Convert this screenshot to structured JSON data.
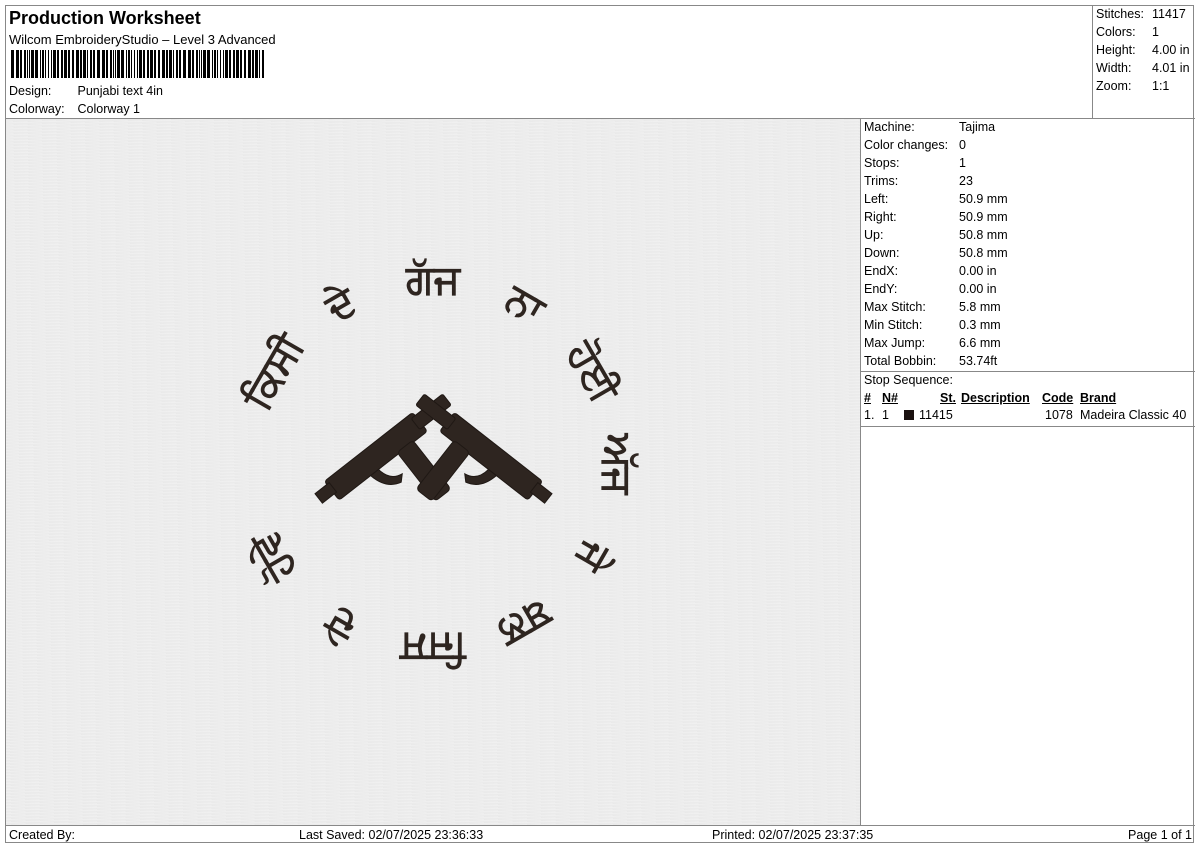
{
  "header": {
    "title": "Production Worksheet",
    "software": "Wilcom EmbroideryStudio – Level 3 Advanced",
    "design_label": "Design:",
    "design_value": "Punjabi text 4in",
    "colorway_label": "Colorway:",
    "colorway_value": "Colorway 1"
  },
  "stats": {
    "stitches_label": "Stitches:",
    "stitches_value": "11417",
    "colors_label": "Colors:",
    "colors_value": "1",
    "height_label": "Height:",
    "height_value": "4.00 in",
    "width_label": "Width:",
    "width_value": "4.01 in",
    "zoom_label": "Zoom:",
    "zoom_value": "1:1"
  },
  "machine_info": [
    {
      "label": "Machine:",
      "value": "Tajima"
    },
    {
      "label": "Color changes:",
      "value": "0"
    },
    {
      "label": "Stops:",
      "value": "1"
    },
    {
      "label": "Trims:",
      "value": "23"
    },
    {
      "label": "Left:",
      "value": "50.9 mm"
    },
    {
      "label": "Right:",
      "value": "50.9 mm"
    },
    {
      "label": "Up:",
      "value": "50.8 mm"
    },
    {
      "label": "Down:",
      "value": "50.8 mm"
    },
    {
      "label": "EndX:",
      "value": "0.00 in"
    },
    {
      "label": "EndY:",
      "value": "0.00 in"
    },
    {
      "label": "Max Stitch:",
      "value": "5.8 mm"
    },
    {
      "label": "Min Stitch:",
      "value": "0.3 mm"
    },
    {
      "label": "Max Jump:",
      "value": "6.6 mm"
    },
    {
      "label": "Total Bobbin:",
      "value": "53.74ft"
    }
  ],
  "stop_sequence": {
    "title": "Stop Sequence:",
    "headers": {
      "index": "#",
      "needle": "N#",
      "stitches": "St.",
      "description": "Description",
      "code": "Code",
      "brand": "Brand"
    },
    "rows": [
      {
        "index": "1.",
        "needle": "1",
        "color": "#1a1110",
        "stitches": "11415",
        "description": "",
        "code": "1078",
        "brand": "Madeira Classic 40"
      }
    ]
  },
  "design_preview": {
    "thread_color": "#2e2520",
    "ring_text": [
      "ਕਿਸੀ",
      "ਦੇ",
      "ਗੱਜ",
      "ਨਾ",
      "ਹੋਈ",
      "ਅੱਜ",
      "ਜੇ",
      "ਬਲ",
      "ਜਿਸ",
      "ਦੇ",
      "ਹੋਵੇ"
    ]
  },
  "footer": {
    "created_by": "Created By:",
    "last_saved": "Last Saved: 02/07/2025 23:36:33",
    "printed": "Printed: 02/07/2025 23:37:35",
    "page": "Page 1 of 1"
  }
}
